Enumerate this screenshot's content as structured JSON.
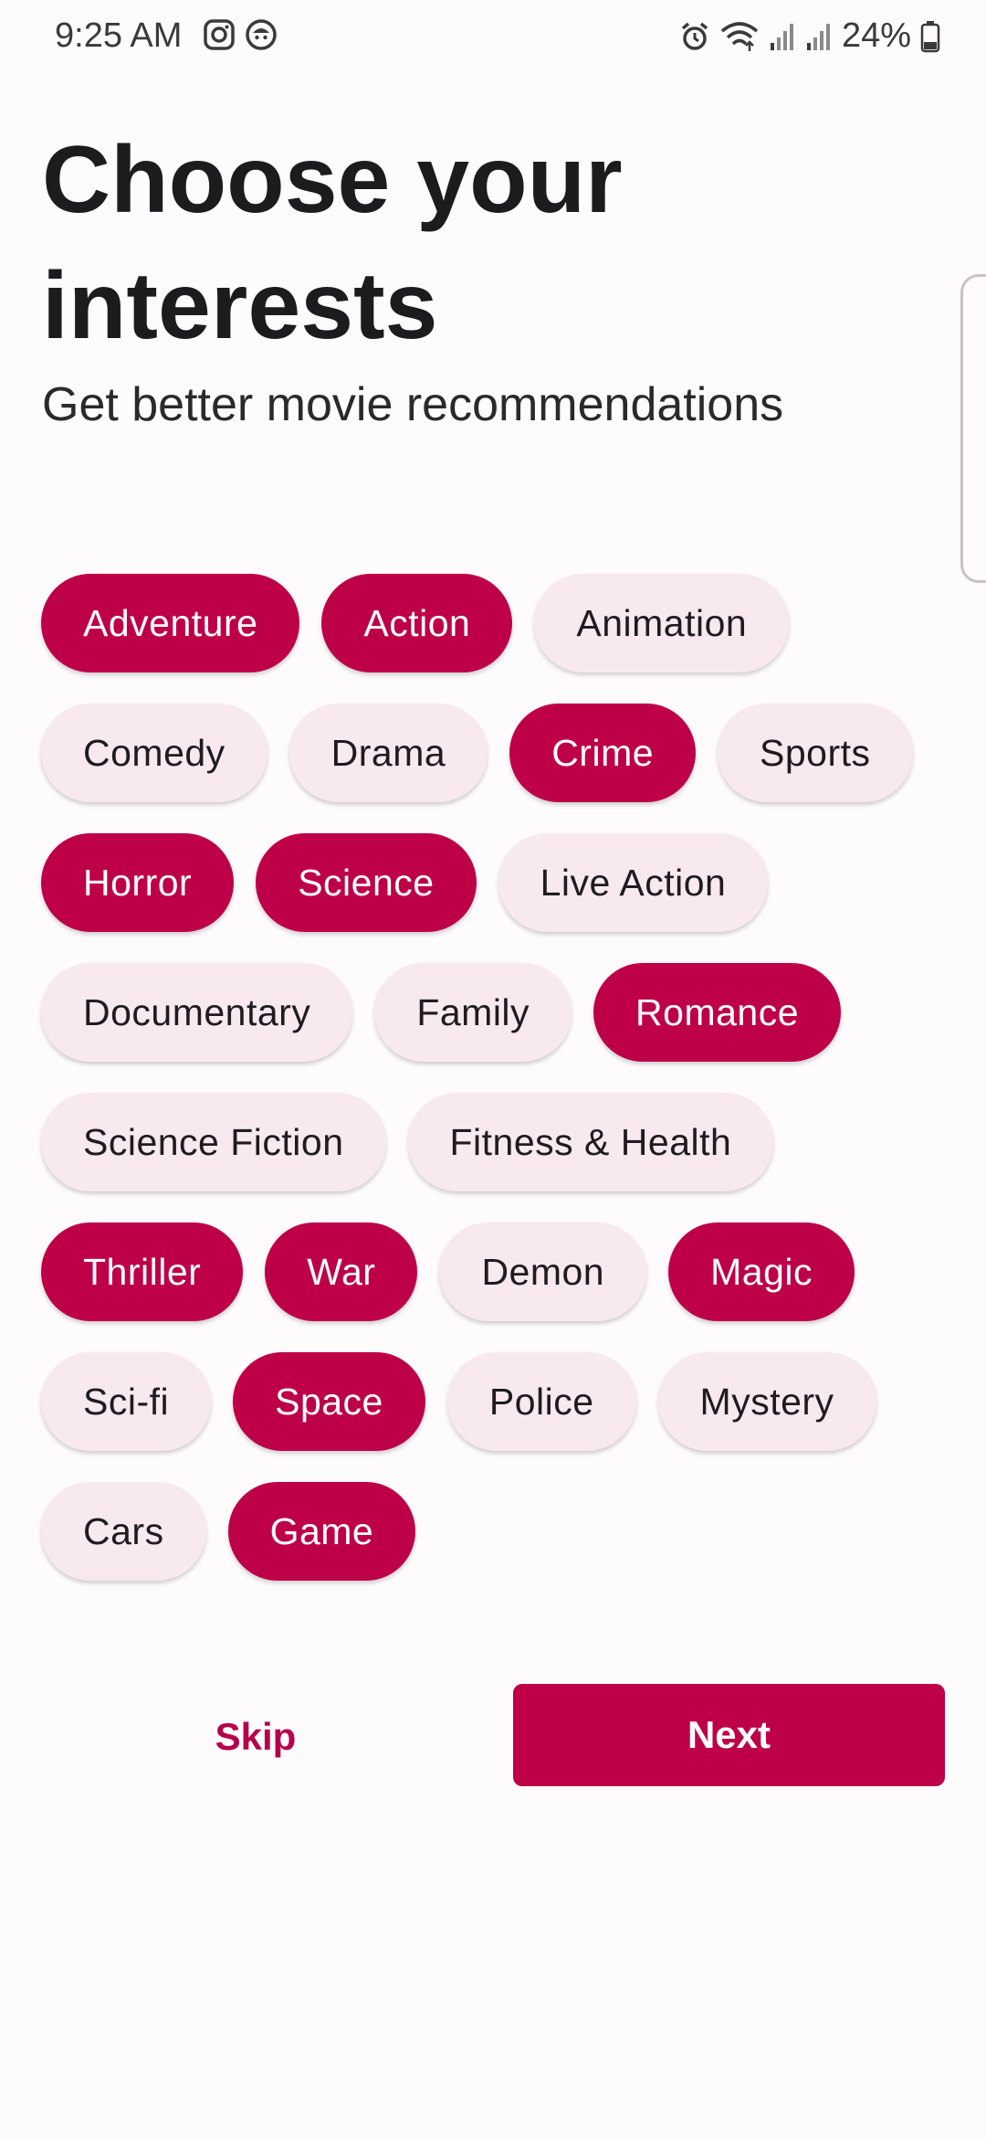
{
  "status_bar": {
    "time": "9:25 AM",
    "battery": "24%",
    "left_icons": [
      "instagram-icon",
      "app-notification-icon"
    ],
    "right_icons": [
      "alarm-icon",
      "wifi-icon",
      "signal-icon",
      "signal-icon",
      "battery-icon"
    ]
  },
  "header": {
    "title": "Choose your interests",
    "subtitle": "Get better movie recommendations"
  },
  "interests": [
    {
      "label": "Adventure",
      "selected": true
    },
    {
      "label": "Action",
      "selected": true
    },
    {
      "label": "Animation",
      "selected": false
    },
    {
      "label": "Comedy",
      "selected": false
    },
    {
      "label": "Drama",
      "selected": false
    },
    {
      "label": "Crime",
      "selected": true
    },
    {
      "label": "Sports",
      "selected": false
    },
    {
      "label": "Horror",
      "selected": true
    },
    {
      "label": "Science",
      "selected": true
    },
    {
      "label": "Live Action",
      "selected": false
    },
    {
      "label": "Documentary",
      "selected": false
    },
    {
      "label": "Family",
      "selected": false
    },
    {
      "label": "Romance",
      "selected": true
    },
    {
      "label": "Science Fiction",
      "selected": false
    },
    {
      "label": "Fitness & Health",
      "selected": false
    },
    {
      "label": "Thriller",
      "selected": true
    },
    {
      "label": "War",
      "selected": true
    },
    {
      "label": "Demon",
      "selected": false
    },
    {
      "label": "Magic",
      "selected": true
    },
    {
      "label": "Sci-fi",
      "selected": false
    },
    {
      "label": "Space",
      "selected": true
    },
    {
      "label": "Police",
      "selected": false
    },
    {
      "label": "Mystery",
      "selected": false
    },
    {
      "label": "Cars",
      "selected": false
    },
    {
      "label": "Game",
      "selected": true
    }
  ],
  "actions": {
    "skip_label": "Skip",
    "next_label": "Next"
  },
  "colors": {
    "accent": "#bd0048",
    "chip_unselected": "#f8e9ef",
    "background": "#fefbfd"
  }
}
